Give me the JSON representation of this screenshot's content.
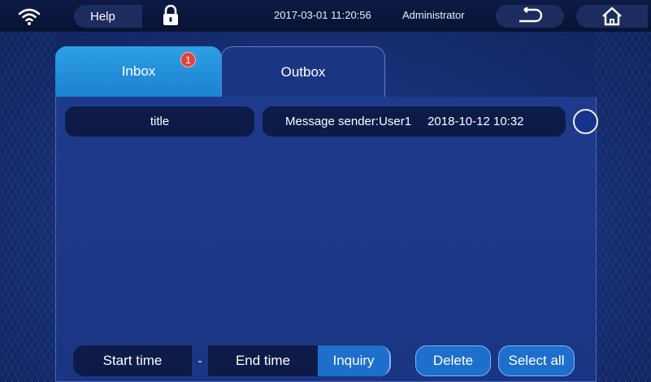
{
  "topbar": {
    "wifi_icon": "wifi-icon",
    "help_label": "Help",
    "lock_icon": "lock-icon",
    "datetime": "2017-03-01  11:20:56",
    "user": "Administrator",
    "back_icon": "back-arrow-icon",
    "home_icon": "home-icon"
  },
  "tabs": [
    {
      "label": "Inbox",
      "active": true,
      "badge": "1"
    },
    {
      "label": "Outbox",
      "active": false
    }
  ],
  "list": {
    "header_title": "title",
    "messages": [
      {
        "sender": "Message sender:User1",
        "time": "2018-10-12 10:32",
        "selected": false
      }
    ]
  },
  "controls": {
    "start_time": "Start time",
    "separator": "-",
    "end_time": "End time",
    "inquiry": "Inquiry",
    "delete": "Delete",
    "select_all": "Select all"
  },
  "colors": {
    "accent_tab": "#2ea0e4",
    "button_blue": "#1d6fcb",
    "badge_red": "#e0413f",
    "dark_field": "#0c1b48"
  }
}
